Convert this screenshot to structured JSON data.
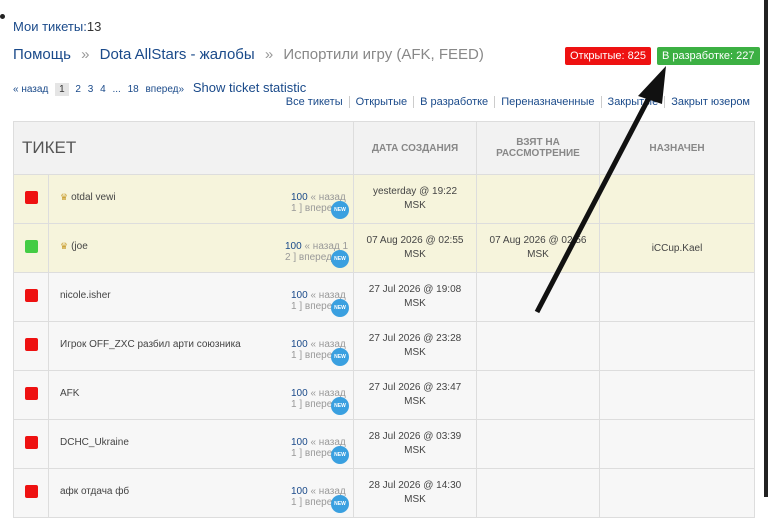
{
  "header": {
    "my_tickets_label": "Мои тикеты:",
    "my_tickets_count": "13"
  },
  "breadcrumb": {
    "home": "Помощь",
    "sep": "»",
    "section": "Dota AllStars - жалобы",
    "current": "Испортили игру (AFK, FEED)"
  },
  "badges": {
    "open": "Открытые: 825",
    "dev": "В разработке: 227"
  },
  "pager": {
    "prev": "« назад",
    "pages": [
      "1",
      "2",
      "3",
      "4"
    ],
    "ellipsis": "...",
    "last": "18",
    "next": "вперед»",
    "stat": "Show ticket statistic"
  },
  "filters": [
    "Все тикеты",
    "Открытые",
    "В разработке",
    "Переназначенные",
    "Закрытые",
    "Закрыт юзером"
  ],
  "table": {
    "headers": [
      "ТИКЕТ",
      "ДАТА СОЗДАНИЯ",
      "ВЗЯТ НА РАССМОТРЕНИЕ",
      "НАЗНАЧЕН"
    ],
    "rows": [
      {
        "status": "red",
        "name": "otdal vewi",
        "crown": "♛",
        "count": "100",
        "pages": "« назад 1 ] вперед »",
        "created": "yesterday @ 19:22",
        "tz": "MSK",
        "taken": "",
        "taken_tz": "",
        "assignee": ""
      },
      {
        "status": "green",
        "name": "(joe",
        "crown": "♛",
        "count": "100",
        "pages": "« назад 1 2 ] вперед »",
        "created": "07 Aug 2026 @ 02:55",
        "tz": "MSK",
        "taken": "07 Aug 2026 @ 02:56",
        "taken_tz": "MSK",
        "assignee": "iCCup.Kael"
      },
      {
        "status": "red",
        "name": "nicole.isher",
        "crown": "",
        "count": "100",
        "pages": "« назад 1 ] вперед »",
        "created": "27 Jul 2026 @ 19:08",
        "tz": "MSK",
        "taken": "",
        "taken_tz": "",
        "assignee": ""
      },
      {
        "status": "red",
        "name": "Игрок OFF_ZXC разбил арти союзника",
        "crown": "",
        "count": "100",
        "pages": "« назад 1 ] вперед »",
        "created": "27 Jul 2026 @ 23:28",
        "tz": "MSK",
        "taken": "",
        "taken_tz": "",
        "assignee": ""
      },
      {
        "status": "red",
        "name": "AFK",
        "crown": "",
        "count": "100",
        "pages": "« назад 1 ] вперед »",
        "created": "27 Jul 2026 @ 23:47",
        "tz": "MSK",
        "taken": "",
        "taken_tz": "",
        "assignee": ""
      },
      {
        "status": "red",
        "name": "DCHC_Ukraine",
        "crown": "",
        "count": "100",
        "pages": "« назад 1 ] вперед »",
        "created": "28 Jul 2026 @ 03:39",
        "tz": "MSK",
        "taken": "",
        "taken_tz": "",
        "assignee": ""
      },
      {
        "status": "red",
        "name": "афк отдача фб",
        "crown": "",
        "count": "100",
        "pages": "« назад 1 ] вперед »",
        "created": "28 Jul 2026 @ 14:30",
        "tz": "MSK",
        "taken": "",
        "taken_tz": "",
        "assignee": ""
      }
    ]
  },
  "new_icon_text": "NEW",
  "colors": {
    "link": "#1a4a8a",
    "open": "#e11111",
    "dev": "#3cb043",
    "highlight": "#f6f4dc"
  }
}
